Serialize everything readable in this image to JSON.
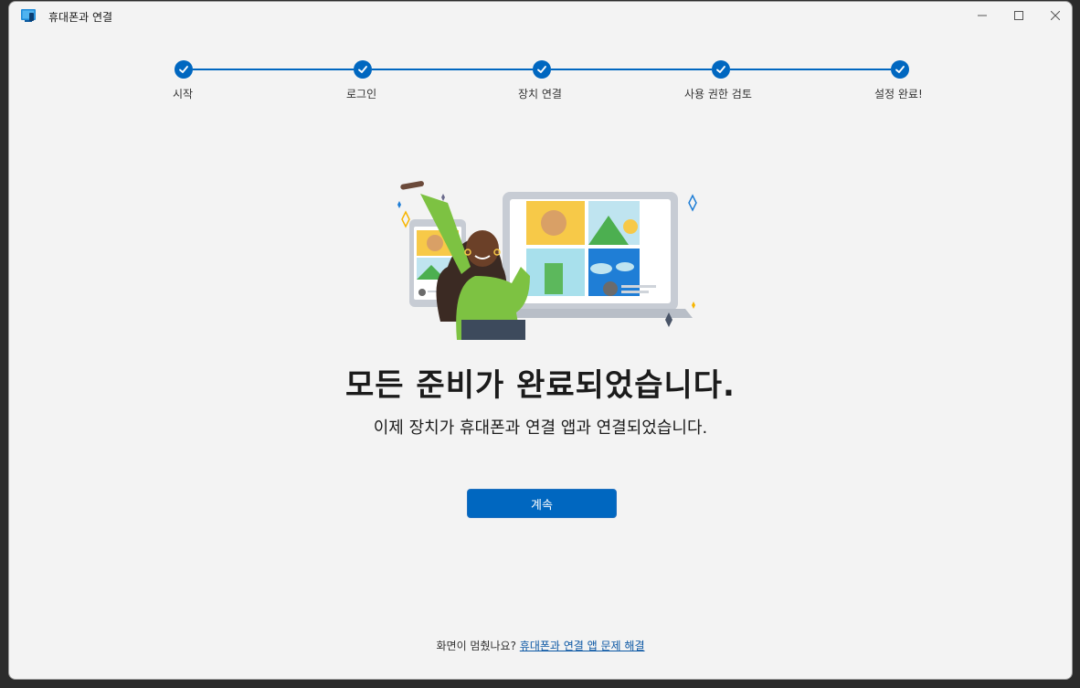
{
  "window": {
    "title": "휴대폰과 연결"
  },
  "caption_buttons": {
    "minimize": "—",
    "maximize": "☐",
    "close": "✕"
  },
  "stepper": {
    "steps": [
      {
        "label": "시작",
        "status": "complete"
      },
      {
        "label": "로그인",
        "status": "complete"
      },
      {
        "label": "장치 연결",
        "status": "complete"
      },
      {
        "label": "사용 권한 검토",
        "status": "complete"
      },
      {
        "label": "설정 완료!",
        "status": "complete"
      }
    ],
    "accent_color": "#0067c0"
  },
  "main": {
    "heading": "모든 준비가 완료되었습니다.",
    "subheading": "이제 장치가 휴대폰과 연결 앱과 연결되었습니다.",
    "continue_button": "계속"
  },
  "footer": {
    "prompt": "화면이 멈췄나요?",
    "link": "휴대폰과 연결 앱 문제 해결"
  },
  "colors": {
    "accent": "#0067c0",
    "background": "#f3f3f3"
  }
}
